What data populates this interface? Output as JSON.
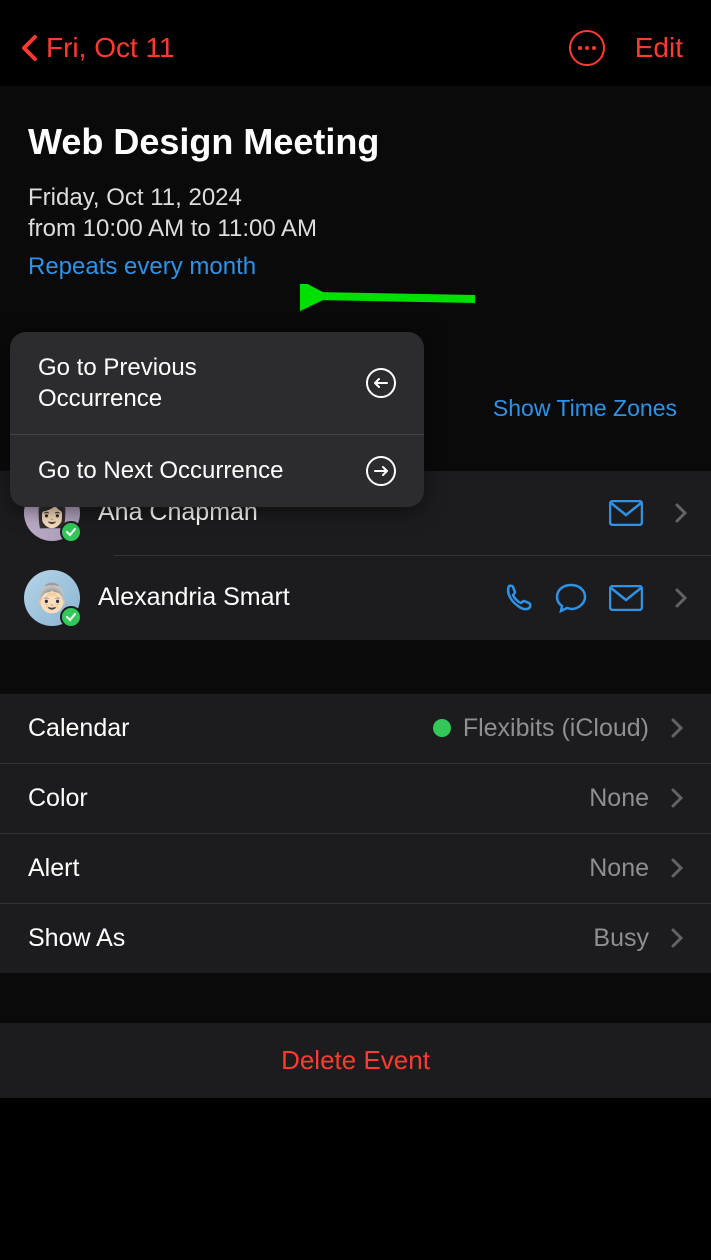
{
  "header": {
    "back_label": "Fri, Oct 11",
    "edit_label": "Edit"
  },
  "event": {
    "title": "Web Design Meeting",
    "date": "Friday, Oct 11, 2024",
    "time": "from 10:00 AM to 11:00 AM",
    "repeats": "Repeats every month",
    "show_timezones": "Show Time Zones"
  },
  "popup": {
    "prev": "Go to Previous Occurrence",
    "next": "Go to Next Occurrence"
  },
  "invitees": [
    {
      "name": "Ana Chapman"
    },
    {
      "name": "Alexandria Smart"
    }
  ],
  "settings": {
    "calendar_label": "Calendar",
    "calendar_value": "Flexibits (iCloud)",
    "color_label": "Color",
    "color_value": "None",
    "alert_label": "Alert",
    "alert_value": "None",
    "showas_label": "Show As",
    "showas_value": "Busy"
  },
  "delete_label": "Delete Event"
}
